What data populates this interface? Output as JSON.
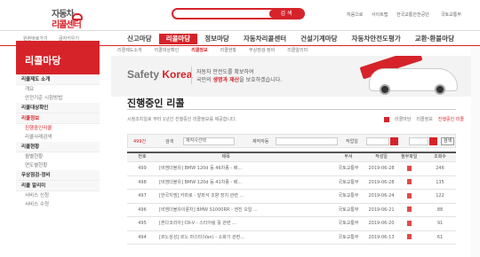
{
  "header": {
    "logo_line1": "자동차",
    "logo_line2": "리콜센터",
    "search_button": "검 색",
    "util_links": [
      "처음으로",
      "사이트맵",
      "한국교통안전공단",
      "국토교통부"
    ]
  },
  "top_left_links": [
    "원본바로가기",
    "글자키우기"
  ],
  "gnb": [
    "신고마당",
    "리콜마당",
    "정보마당",
    "자동차리콜센터",
    "건설기계마당",
    "자동차안전도평가",
    "교환·환불마당"
  ],
  "gnb_active_index": 1,
  "lnb": {
    "title": "리콜마당",
    "items": [
      {
        "label": "리콜제도 소개",
        "type": "main"
      },
      {
        "label": "개요",
        "type": "sub"
      },
      {
        "label": "안전기준 시험방법",
        "type": "sub"
      },
      {
        "label": "리콜대상확인",
        "type": "main"
      },
      {
        "label": "리콜정보",
        "type": "main",
        "active": true
      },
      {
        "label": "진행중인리콜",
        "type": "sub",
        "active": true
      },
      {
        "label": "리콜사례검색",
        "type": "sub"
      },
      {
        "label": "리콜현황",
        "type": "main"
      },
      {
        "label": "월별현황",
        "type": "sub"
      },
      {
        "label": "연도별현황",
        "type": "sub"
      },
      {
        "label": "무상점검·정비",
        "type": "main"
      },
      {
        "label": "리콜 알리미",
        "type": "main"
      },
      {
        "label": "서비스 신청",
        "type": "sub"
      },
      {
        "label": "서비스 수정",
        "type": "sub"
      }
    ]
  },
  "subtabs": [
    "리콜제도소개",
    "리콜대상확인",
    "리콜정보",
    "리콜현황",
    "무상점검·정비",
    "리콜알리미"
  ],
  "subtabs_active_index": 2,
  "banner": {
    "brand_a": "Safety ",
    "brand_b": "Korea",
    "line1": "자동차 안전도를 확보하여",
    "line2_pre": "국민의 ",
    "line2_bold": "생명과 재산",
    "line2_post": "을 보호하겠습니다."
  },
  "page": {
    "title": "진행중인 리콜",
    "notice": "시정조치일로 부터 1년간 진행중인 리콜정보를 제공합니다.",
    "path": [
      "리콜마당",
      "리콜정보",
      "진행중인 리콜"
    ]
  },
  "filter": {
    "count_label": "499건",
    "search_label": "검색",
    "select_value": "제작사선택",
    "maker_label": "제작자동",
    "period_label": "작업일",
    "search_button": "검색"
  },
  "table": {
    "headers": [
      "번호",
      "제목",
      "부서",
      "작성일",
      "첨부파일",
      "조회수"
    ],
    "rows": [
      {
        "no": "499",
        "title": "[비엠더블유] BMW 120d 등 46차종 - 배...",
        "dept": "국토교통부",
        "date": "2019-06-28",
        "att": true,
        "views": "246"
      },
      {
        "no": "498",
        "title": "[비엠더블유] BMW 120d 등 41차종 - 배...",
        "dept": "국토교통부",
        "date": "2019-06-28",
        "att": true,
        "views": "135"
      },
      {
        "no": "497",
        "title": "[한국지엠] 카마로 - 앞좌석 조향 장치 관련 ...",
        "dept": "국토교통부",
        "date": "2019-06-24",
        "att": true,
        "views": "122"
      },
      {
        "no": "496",
        "title": "[비엠더블유이륜차] BMW S1000RR - 엔진 오일 ...",
        "dept": "국토교통부",
        "date": "2019-06-21",
        "att": true,
        "views": "88"
      },
      {
        "no": "495",
        "title": "[혼다코리아] CR-V - 스티어링 휠 관련 ...",
        "dept": "국토교통부",
        "date": "2019-06-20",
        "att": true,
        "views": "91"
      },
      {
        "no": "494",
        "title": "[르노삼성] 르노 마스터(Van) - 소화기 관련...",
        "dept": "국토교통부",
        "date": "2019-06-13",
        "att": true,
        "views": "61"
      }
    ]
  },
  "colors": {
    "accent": "#d6232a"
  }
}
